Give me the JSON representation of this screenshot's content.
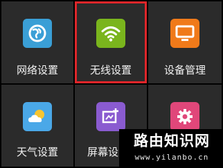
{
  "tiles": [
    {
      "label": "网络设置",
      "icon": "globe-icon",
      "color": "#3a9fd6",
      "selected": false
    },
    {
      "label": "无线设置",
      "icon": "wifi-icon",
      "color": "#7ab51d",
      "selected": true
    },
    {
      "label": "设备管理",
      "icon": "monitor-icon",
      "color": "#f07a1a",
      "selected": false
    },
    {
      "label": "天气设置",
      "icon": "weather-icon",
      "color": "#4aa8e8",
      "selected": false
    },
    {
      "label": "屏幕设",
      "icon": "screen-edit-icon",
      "color": "#8a5bd0",
      "selected": false
    },
    {
      "label": "",
      "icon": "gear-icon",
      "color": "#e0477a",
      "selected": false
    }
  ],
  "watermark": {
    "title": "路由知识网",
    "url": "www.yilanbo.cn"
  },
  "colors": {
    "tile_bg": "#2b2b2b",
    "selection": "#e0262a"
  }
}
